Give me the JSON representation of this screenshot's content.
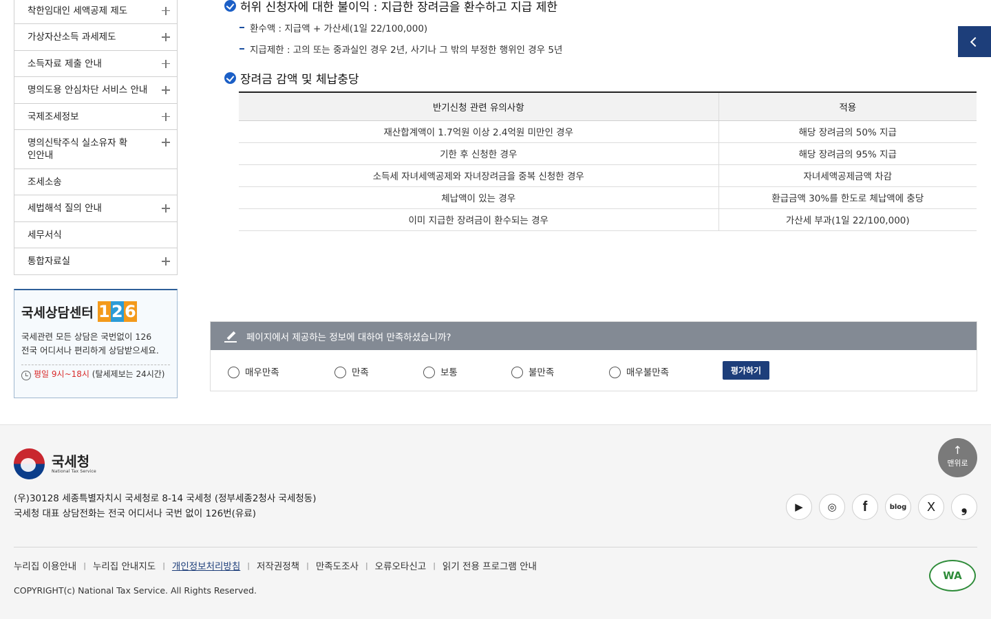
{
  "sidebar": {
    "items": [
      {
        "label": "착한임대인 세액공제 제도",
        "has_plus": true
      },
      {
        "label": "가상자산소득 과세제도",
        "has_plus": true
      },
      {
        "label": "소득자료 제출 안내",
        "has_plus": true
      },
      {
        "label": "명의도용 안심차단 서비스 안내",
        "has_plus": true
      },
      {
        "label": "국제조세정보",
        "has_plus": true
      },
      {
        "label": "명의신탁주식 실소유자 확인안내",
        "has_plus": true
      },
      {
        "label": "조세소송",
        "has_plus": false
      },
      {
        "label": "세법해석 질의 안내",
        "has_plus": true
      },
      {
        "label": "세무서식",
        "has_plus": false
      },
      {
        "label": "통합자료실",
        "has_plus": true
      }
    ]
  },
  "counsel": {
    "title": "국세상담센터",
    "number": "126",
    "desc_line1": "국세관련 모든 상담은 국번없이 126",
    "desc_line2": "전국 어디서나 편리하게 상담받으세요.",
    "hours": "평일 9시~18시",
    "hours_note": "(탈세제보는 24시간)"
  },
  "content": {
    "section1": {
      "heading": "허위 신청자에 대한 불이익 : 지급한 장려금을 환수하고 지급 제한",
      "bullets": [
        "환수액 : 지급액 + 가산세(1일 22/100,000)",
        "지급제한 : 고의 또는 중과실인 경우 2년, 사기나 그 밖의 부정한 행위인 경우 5년"
      ]
    },
    "section2": {
      "heading": "장려금 감액 및 체납충당",
      "table": {
        "headers": [
          "반기신청 관련 유의사항",
          "적용"
        ],
        "rows": [
          [
            "재산합계액이 1.7억원 이상 2.4억원 미만인 경우",
            "해당 장려금의 50% 지급"
          ],
          [
            "기한 후 신청한 경우",
            "해당 장려금의 95% 지급"
          ],
          [
            "소득세 자녀세액공제와 자녀장려금을 중복 신청한 경우",
            "자녀세액공제금액 차감"
          ],
          [
            "체납액이 있는 경우",
            "환급금액 30%를 한도로 체납액에 충당"
          ],
          [
            "이미 지급한 장려금이 환수되는 경우",
            "가산세 부과(1일 22/100,000)"
          ]
        ]
      }
    }
  },
  "survey": {
    "question": "페이지에서 제공하는 정보에 대하여 만족하셨습니까?",
    "options": [
      "매우만족",
      "만족",
      "보통",
      "불만족",
      "매우불만족"
    ],
    "submit_label": "평가하기"
  },
  "footer": {
    "logo_ko": "국세청",
    "logo_en": "National Tax Service",
    "address": "(우)30128 세종특별자치시 국세청로 8-14 국세청 (정부세종2청사 국세청동)",
    "phone_info": "국세청 대표 상담전화는 전국 어디서나 국번 없이 126번(유료)",
    "top_button": "맨위로",
    "links": [
      "누리집 이용안내",
      "누리집 안내지도",
      "개인정보처리방침",
      "저작권정책",
      "만족도조사",
      "오류오타신고",
      "읽기 전용 프로그램 안내"
    ],
    "copyright": "COPYRIGHT(c) National Tax Service. All Rights Reserved.",
    "social": [
      "youtube-icon",
      "instagram-icon",
      "facebook-icon",
      "blog-icon",
      "x-icon",
      "post-icon"
    ],
    "social_glyphs": [
      "▶",
      "◎",
      "f",
      "blog",
      "X",
      "❟"
    ],
    "wa_mark": "WA"
  },
  "colors": {
    "accent": "#1d3e7a",
    "survey_header": "#838a94",
    "check": "#1b5fc6"
  }
}
